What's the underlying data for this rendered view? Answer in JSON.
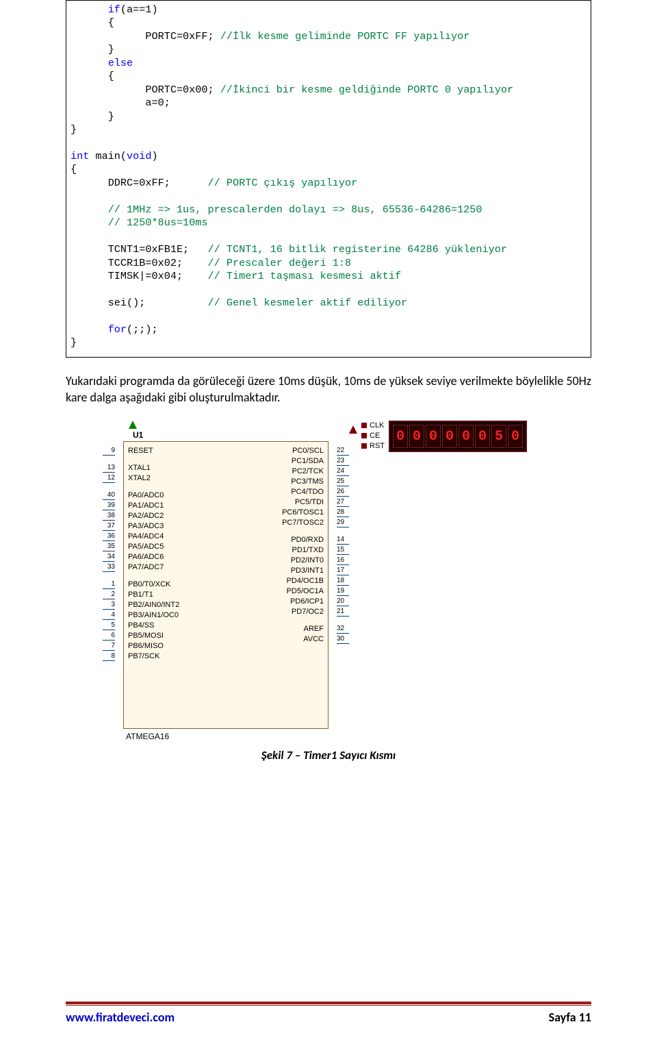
{
  "code": {
    "l1": {
      "kw": "if",
      "cond": "(a==1)"
    },
    "l2": "{",
    "l3": {
      "stmt": "PORTC=0xFF; ",
      "cm": "//İlk kesme geliminde PORTC FF yapılıyor"
    },
    "l4": "}",
    "l5": {
      "kw": "else"
    },
    "l6": "{",
    "l7": {
      "stmt": "PORTC=0x00; ",
      "cm": "//İkinci bir kesme geldiğinde PORTC 0 yapılıyor"
    },
    "l8": {
      "stmt": "a=0;"
    },
    "l9": "}",
    "l10": "}",
    "l11": {
      "kw1": "int",
      "sp": " main(",
      "kw2": "void",
      "end": ")"
    },
    "l12": "{",
    "l13": {
      "stmt": "DDRC=0xFF;",
      "cm": "// PORTC çıkış yapılıyor"
    },
    "l14": {
      "cm": "// 1MHz => 1us, prescalerden dolayı => 8us, 65536-64286=1250"
    },
    "l15": {
      "cm": "// 1250*8us=10ms"
    },
    "l16": {
      "stmt": "TCNT1=0xFB1E;",
      "cm": "// TCNT1, 16 bitlik registerine 64286 yükleniyor"
    },
    "l17": {
      "stmt": "TCCR1B=0x02;",
      "cm": "// Prescaler değeri 1:8"
    },
    "l18": {
      "stmt": "TIMSK|=0x04;",
      "cm": "// Timer1 taşması kesmesi aktif"
    },
    "l19": {
      "stmt": "sei();",
      "cm": "// Genel kesmeler aktif ediliyor"
    },
    "l20": {
      "kw": "for",
      "rest": "(;;);"
    },
    "l21": "}"
  },
  "para": "Yukarıdaki programda da görüleceği üzere 10ms düşük, 10ms de yüksek seviye verilmekte böylelikle 50Hz kare dalga aşağıdaki gibi oluşturulmaktadır.",
  "schematic": {
    "ref": "U1",
    "name": "ATMEGA16",
    "left_sections": [
      {
        "pins": [
          {
            "n": "9",
            "lbl": "RESET"
          }
        ]
      },
      {
        "pins": [
          {
            "n": "13",
            "lbl": "XTAL1"
          },
          {
            "n": "12",
            "lbl": "XTAL2"
          }
        ]
      },
      {
        "pins": [
          {
            "n": "40",
            "lbl": "PA0/ADC0"
          },
          {
            "n": "39",
            "lbl": "PA1/ADC1"
          },
          {
            "n": "38",
            "lbl": "PA2/ADC2"
          },
          {
            "n": "37",
            "lbl": "PA3/ADC3"
          },
          {
            "n": "36",
            "lbl": "PA4/ADC4"
          },
          {
            "n": "35",
            "lbl": "PA5/ADC5"
          },
          {
            "n": "34",
            "lbl": "PA6/ADC6"
          },
          {
            "n": "33",
            "lbl": "PA7/ADC7"
          }
        ]
      },
      {
        "pins": [
          {
            "n": "1",
            "lbl": "PB0/T0/XCK"
          },
          {
            "n": "2",
            "lbl": "PB1/T1"
          },
          {
            "n": "3",
            "lbl": "PB2/AIN0/INT2"
          },
          {
            "n": "4",
            "lbl": "PB3/AIN1/OC0"
          },
          {
            "n": "5",
            "lbl": "PB4/SS"
          },
          {
            "n": "6",
            "lbl": "PB5/MOSI"
          },
          {
            "n": "7",
            "lbl": "PB6/MISO"
          },
          {
            "n": "8",
            "lbl": "PB7/SCK"
          }
        ]
      }
    ],
    "right_sections": [
      {
        "pins": [
          {
            "n": "22",
            "lbl": "PC0/SCL"
          },
          {
            "n": "23",
            "lbl": "PC1/SDA"
          },
          {
            "n": "24",
            "lbl": "PC2/TCK"
          },
          {
            "n": "25",
            "lbl": "PC3/TMS"
          },
          {
            "n": "26",
            "lbl": "PC4/TDO"
          },
          {
            "n": "27",
            "lbl": "PC5/TDI"
          },
          {
            "n": "28",
            "lbl": "PC6/TOSC1"
          },
          {
            "n": "29",
            "lbl": "PC7/TOSC2"
          }
        ]
      },
      {
        "pins": [
          {
            "n": "14",
            "lbl": "PD0/RXD"
          },
          {
            "n": "15",
            "lbl": "PD1/TXD"
          },
          {
            "n": "16",
            "lbl": "PD2/INT0"
          },
          {
            "n": "17",
            "lbl": "PD3/INT1"
          },
          {
            "n": "18",
            "lbl": "PD4/OC1B"
          },
          {
            "n": "19",
            "lbl": "PD5/OC1A"
          },
          {
            "n": "20",
            "lbl": "PD6/ICP1"
          },
          {
            "n": "21",
            "lbl": "PD7/OC2"
          }
        ]
      },
      {
        "pins": [
          {
            "n": "32",
            "lbl": "AREF"
          },
          {
            "n": "30",
            "lbl": "AVCC"
          }
        ]
      }
    ],
    "counter": {
      "pins": [
        "CLK",
        "CE",
        "RST"
      ],
      "digits": [
        "0",
        "0",
        "0",
        "0",
        "0",
        "0",
        "5",
        "0"
      ]
    }
  },
  "caption": "Şekil 7 – Timer1 Sayıcı Kısmı",
  "footer": {
    "left": "www.firatdeveci.com",
    "right": "Sayfa 11"
  }
}
